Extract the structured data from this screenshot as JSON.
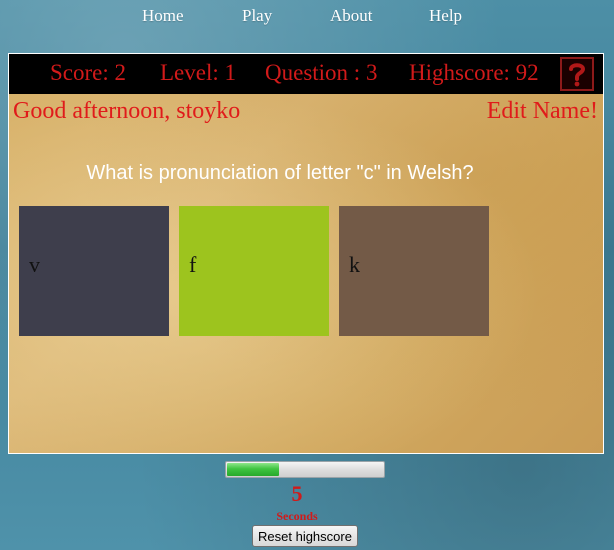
{
  "nav": {
    "items": [
      {
        "label": "Home"
      },
      {
        "label": "Play"
      },
      {
        "label": "About"
      },
      {
        "label": "Help"
      }
    ]
  },
  "status": {
    "score": "Score: 2",
    "level": "Level: 1",
    "question": "Question : 3",
    "highscore": "Highscore: 92",
    "help_icon": "question-mark-icon"
  },
  "greeting": "Good afternoon, stoyko",
  "edit_name": "Edit Name!",
  "question_text": "What is pronunciation of letter \"c\" in Welsh?",
  "answers": [
    {
      "label": "v",
      "color": "#3e3e4c"
    },
    {
      "label": "f",
      "color": "#9dc41e"
    },
    {
      "label": "k",
      "color": "#735a47"
    }
  ],
  "timer": {
    "seconds": "5",
    "seconds_label": "Seconds",
    "progress": 0.33
  },
  "reset_button": "Reset highscore",
  "colors": {
    "accent_red": "#d11a1a",
    "progress_green": "#3fc441"
  }
}
